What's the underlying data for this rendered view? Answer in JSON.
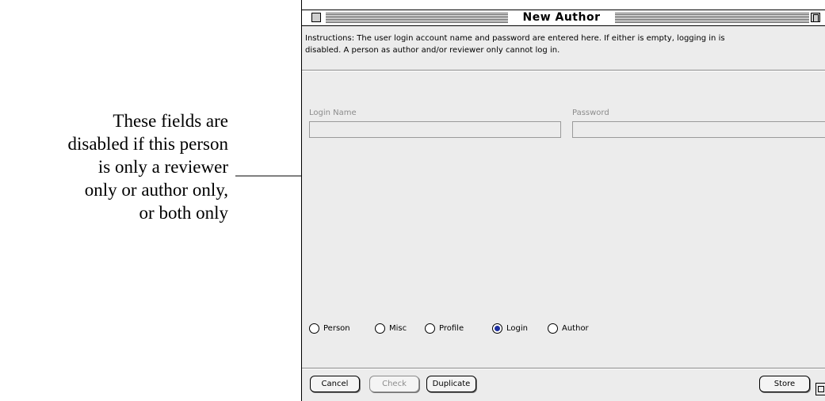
{
  "callout": {
    "lines": [
      "These fields are",
      "disabled if this person",
      "is only a reviewer",
      "only or author only,",
      "or both only"
    ]
  },
  "window": {
    "title": "New Author",
    "instructions_line1": "Instructions: The user login account name and password are entered here.  If either is empty, logging in is",
    "instructions_line2": "disabled.  A person as author and/or reviewer only cannot log in."
  },
  "fields": {
    "login_name": {
      "label": "Login Name",
      "value": "",
      "enabled": false
    },
    "password": {
      "label": "Password",
      "value": "",
      "enabled": false
    }
  },
  "tabs": [
    {
      "label": "Person",
      "selected": false
    },
    {
      "label": "Misc",
      "selected": false
    },
    {
      "label": "Profile",
      "selected": false
    },
    {
      "label": "Login",
      "selected": true
    },
    {
      "label": "Author",
      "selected": false
    }
  ],
  "buttons": {
    "cancel": "Cancel",
    "check": "Check",
    "duplicate": "Duplicate",
    "store": "Store"
  },
  "colors": {
    "radio_selected": "#1e2f9f",
    "disabled_text": "#8c8c8c",
    "panel_background": "#ececec"
  }
}
